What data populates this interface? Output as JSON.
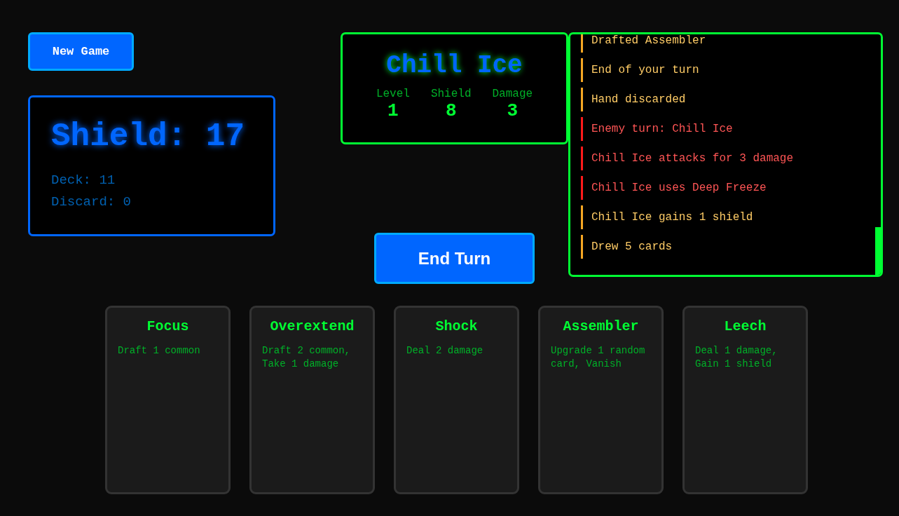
{
  "new_game_button": "New Game",
  "player": {
    "shield": "Shield: 17",
    "deck": "Deck: 11",
    "discard": "Discard: 0"
  },
  "enemy": {
    "name": "Chill Ice",
    "stats": [
      {
        "label": "Level",
        "value": "1"
      },
      {
        "label": "Shield",
        "value": "8"
      },
      {
        "label": "Damage",
        "value": "3"
      }
    ]
  },
  "end_turn_button": "End Turn",
  "log": [
    {
      "text": "Drafted Assembler",
      "kind": "player"
    },
    {
      "text": "End of your turn",
      "kind": "player"
    },
    {
      "text": "Hand discarded",
      "kind": "player"
    },
    {
      "text": "Enemy turn: Chill Ice",
      "kind": "enemy"
    },
    {
      "text": "Chill Ice attacks for 3 damage",
      "kind": "enemy"
    },
    {
      "text": "Chill Ice uses Deep Freeze",
      "kind": "enemy"
    },
    {
      "text": "Chill Ice gains 1 shield",
      "kind": "player"
    },
    {
      "text": "Drew 5 cards",
      "kind": "player"
    }
  ],
  "hand": [
    {
      "title": "Focus",
      "text": "Draft 1 common"
    },
    {
      "title": "Overextend",
      "text": "Draft 2 common, Take 1 damage"
    },
    {
      "title": "Shock",
      "text": "Deal 2 damage"
    },
    {
      "title": "Assembler",
      "text": "Upgrade 1 random card, Vanish"
    },
    {
      "title": "Leech",
      "text": "Deal 1 damage, Gain 1 shield"
    }
  ]
}
